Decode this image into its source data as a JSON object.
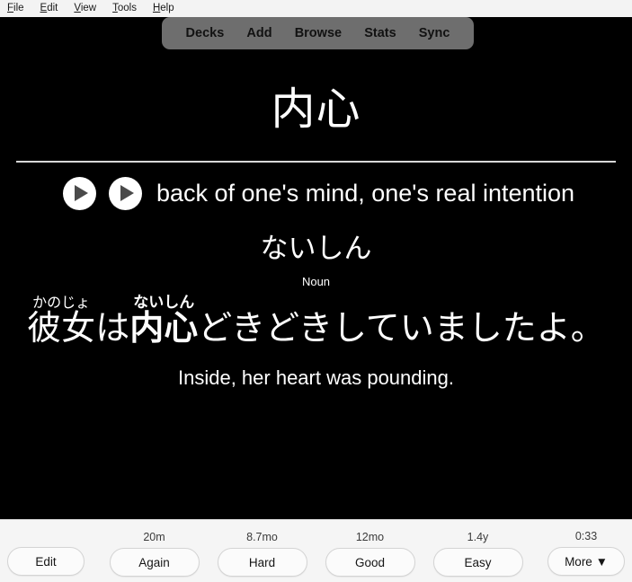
{
  "menubar": {
    "items": [
      {
        "mnemonic": "F",
        "rest": "ile"
      },
      {
        "mnemonic": "E",
        "rest": "dit"
      },
      {
        "mnemonic": "V",
        "rest": "iew"
      },
      {
        "mnemonic": "T",
        "rest": "ools"
      },
      {
        "mnemonic": "H",
        "rest": "elp"
      }
    ]
  },
  "nav": {
    "decks": "Decks",
    "add": "Add",
    "browse": "Browse",
    "stats": "Stats",
    "sync": "Sync"
  },
  "card": {
    "headword": "内心",
    "definition": "back of one's mind, one's real intention",
    "reading": "ないしん",
    "part_of_speech": "Noun",
    "sentence": {
      "seg1_base": "彼女",
      "seg1_ruby": "かのじょ",
      "seg2": "は",
      "seg3_base": "内心",
      "seg3_ruby": "ないしん",
      "seg4": "どきどきしていましたよ。"
    },
    "translation": "Inside, her heart was pounding."
  },
  "bottom": {
    "edit_label": "Edit",
    "more_label": "More ▼",
    "timer": "0:33",
    "answers": [
      {
        "interval": "20m",
        "label": "Again"
      },
      {
        "interval": "8.7mo",
        "label": "Hard"
      },
      {
        "interval": "12mo",
        "label": "Good"
      },
      {
        "interval": "1.4y",
        "label": "Easy"
      }
    ]
  }
}
